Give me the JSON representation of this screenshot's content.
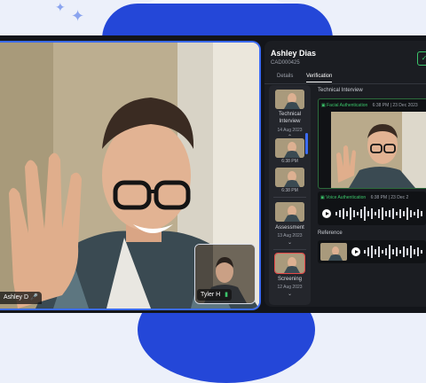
{
  "colors": {
    "accent": "#3b6bf4",
    "verified": "#3bc46a",
    "alert": "#e64848",
    "background_blue": "#2447d8"
  },
  "self_view": {
    "participant_label": "Ashley D",
    "mic_icon": "mic-icon"
  },
  "pip_view": {
    "participant_label": "Tyler H"
  },
  "candidate": {
    "name": "Ashley Dias",
    "id": "CAD000425"
  },
  "tabs": [
    {
      "label": "Details"
    },
    {
      "label": "Verification",
      "active": true
    }
  ],
  "stages": [
    {
      "label_line1": "Technical",
      "label_line2": "Interview",
      "date": "14 Aug 2023"
    },
    {
      "label_line1": "",
      "label_line2": "Assessment",
      "date": "13 Aug 2023"
    },
    {
      "label_line1": "",
      "label_line2": "Screening",
      "date": "12 Aug 2023"
    }
  ],
  "thumb_times": [
    "6:38 PM",
    "6:38 PM",
    "6:38 PM"
  ],
  "detail": {
    "section_title": "Technical Interview",
    "face_auth": {
      "label": "Facial Authentication",
      "meta": "6:38 PM | 23 Dec 2023"
    },
    "voice_auth": {
      "label": "Voice Authentication",
      "meta": "6:38 PM | 23 Dec 2"
    },
    "reference_title": "Reference"
  }
}
